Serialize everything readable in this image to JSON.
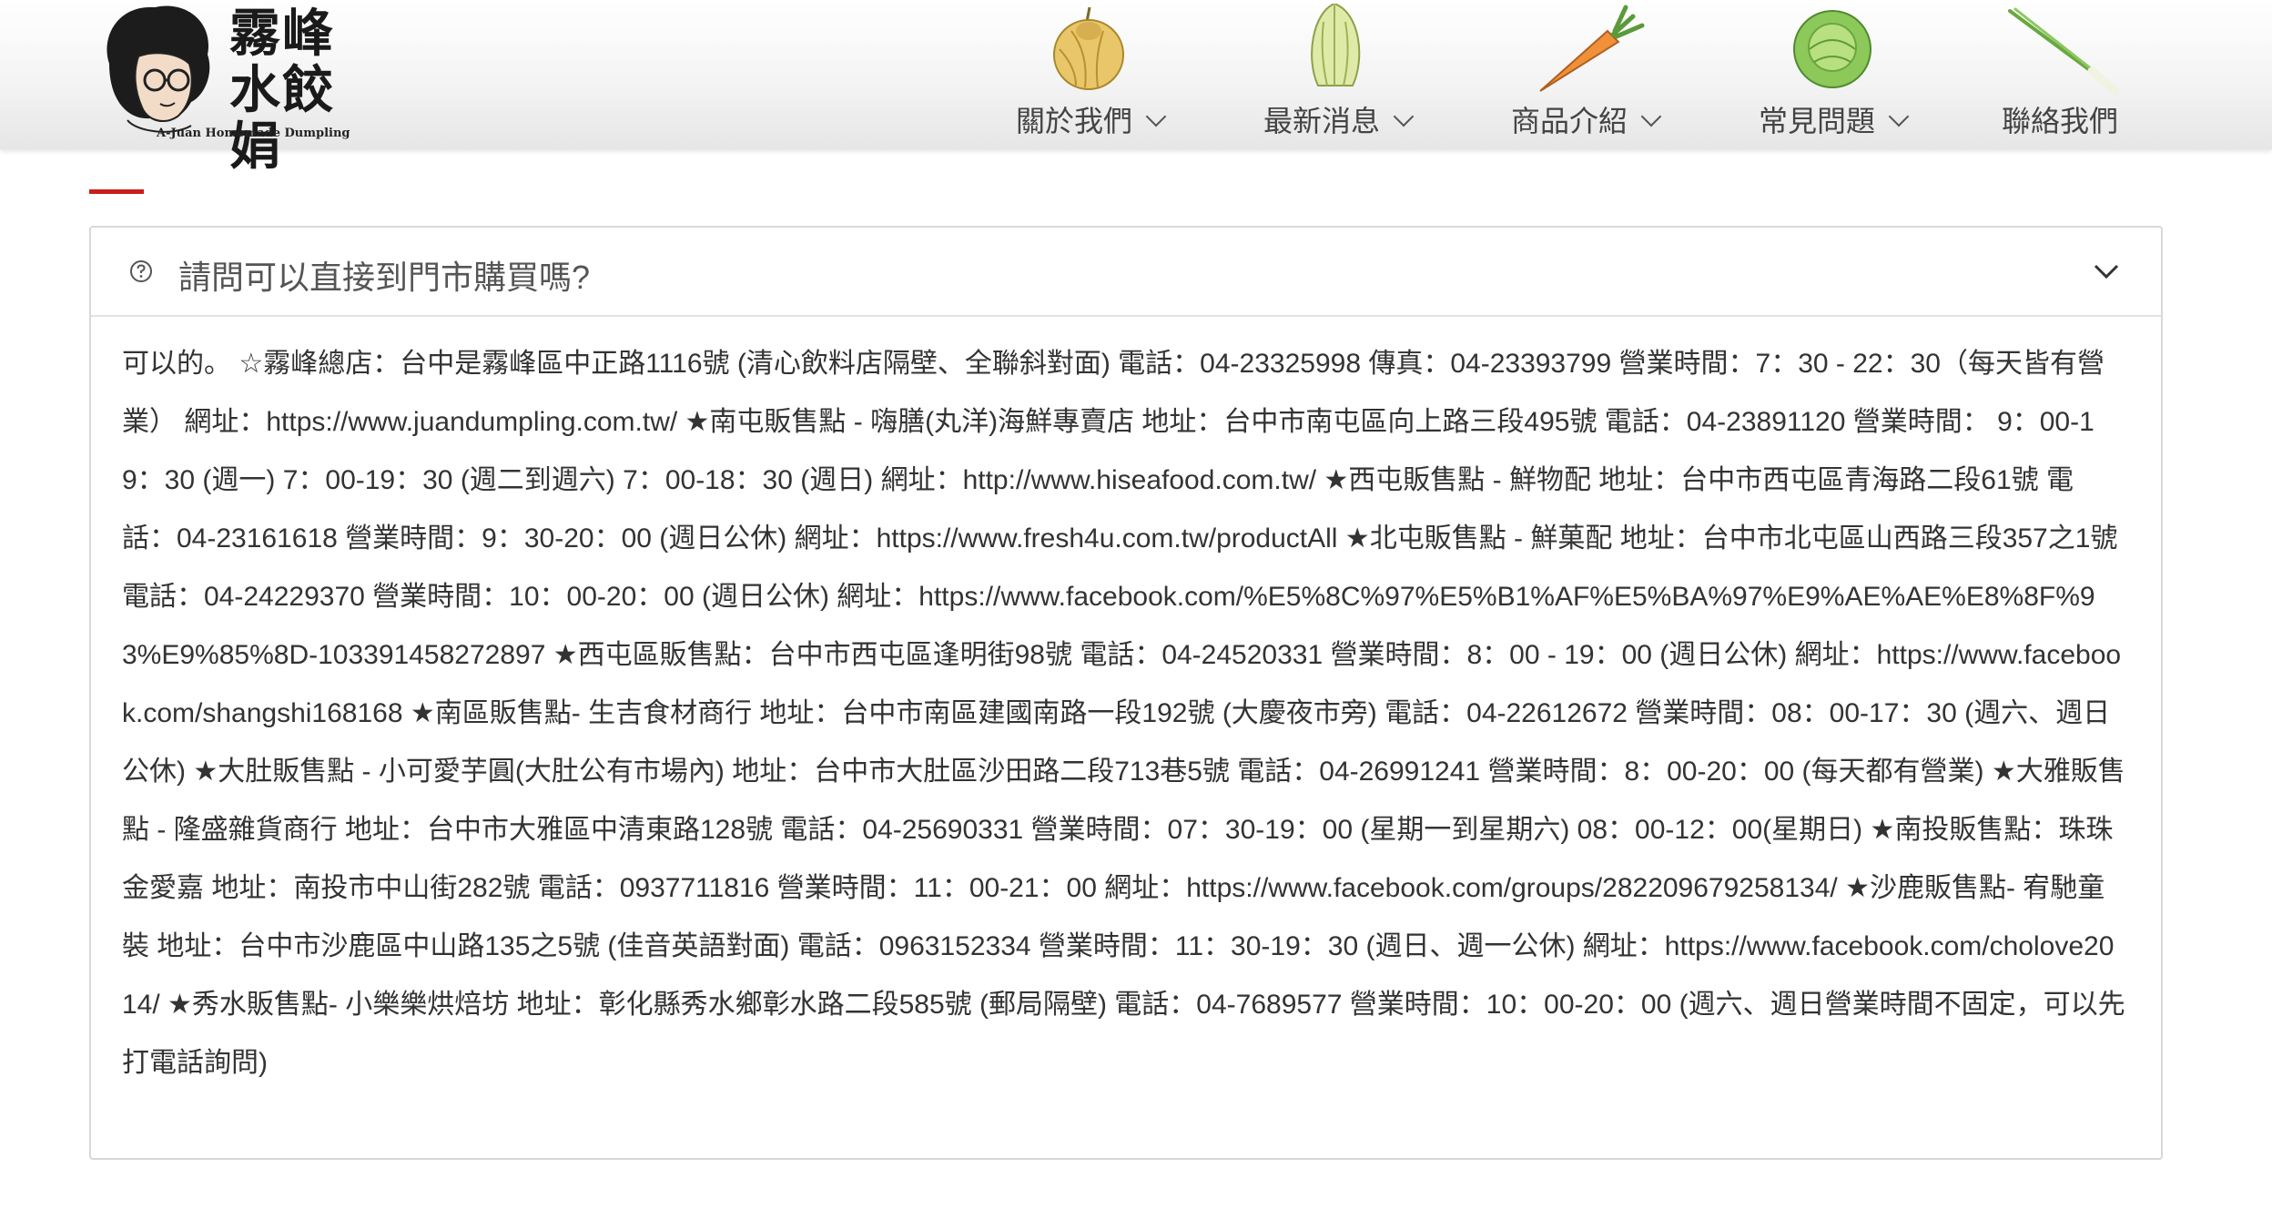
{
  "logo": {
    "title": "霧峰水餃娟",
    "subtitle": "A-Juan Homemade Dumpling"
  },
  "nav": [
    {
      "label": "關於我們",
      "icon": "onion-icon",
      "has_dropdown": true
    },
    {
      "label": "最新消息",
      "icon": "cabbage-icon",
      "has_dropdown": true
    },
    {
      "label": "商品介紹",
      "icon": "carrot-icon",
      "has_dropdown": true
    },
    {
      "label": "常見問題",
      "icon": "lettuce-icon",
      "has_dropdown": true
    },
    {
      "label": "聯絡我們",
      "icon": "scallion-icon",
      "has_dropdown": false
    }
  ],
  "faq": {
    "question": "請問可以直接到門市購買嗎?",
    "answer": "可以的。 ☆霧峰總店：台中是霧峰區中正路1116號 (清心飲料店隔壁、全聯斜對面) 電話：04-23325998 傳真：04-23393799 營業時間：7：30 - 22：30（每天皆有營業） 網址：https://www.juandumpling.com.tw/ ★南屯販售點 - 嗨膳(丸洋)海鮮專賣店 地址：台中市南屯區向上路三段495號 電話：04-23891120 營業時間： 9：00-19：30 (週一) 7：00-19：30 (週二到週六) 7：00-18：30 (週日) 網址：http://www.hiseafood.com.tw/ ★西屯販售點 - 鮮物配 地址：台中市西屯區青海路二段61號 電話：04-23161618 營業時間：9：30-20：00 (週日公休) 網址：https://www.fresh4u.com.tw/productAll ★北屯販售點 - 鮮菓配 地址：台中市北屯區山西路三段357之1號 電話：04-24229370 營業時間：10：00-20：00 (週日公休) 網址：https://www.facebook.com/%E5%8C%97%E5%B1%AF%E5%BA%97%E9%AE%AE%E8%8F%93%E9%85%8D-103391458272897 ★西屯區販售點：台中市西屯區逢明街98號 電話：04-24520331 營業時間：8：00 - 19：00 (週日公休) 網址：https://www.facebook.com/shangshi168168 ★南區販售點- 生吉食材商行 地址：台中市南區建國南路一段192號 (大慶夜市旁) 電話：04-22612672 營業時間：08：00-17：30 (週六、週日公休) ★大肚販售點 - 小可愛芋圓(大肚公有市場內) 地址：台中市大肚區沙田路二段713巷5號 電話：04-26991241 營業時間：8：00-20：00 (每天都有營業) ★大雅販售點 - 隆盛雜貨商行 地址：台中市大雅區中清東路128號 電話：04-25690331 營業時間：07：30-19：00 (星期一到星期六) 08：00-12：00(星期日) ★南投販售點：珠珠金愛嘉 地址：南投市中山街282號 電話：0937711816 營業時間：11：00-21：00 網址：https://www.facebook.com/groups/282209679258134/ ★沙鹿販售點- 宥馳童裝 地址：台中市沙鹿區中山路135之5號 (佳音英語對面) 電話：0963152334 營業時間：11：30-19：30 (週日、週一公休) 網址：https://www.facebook.com/cholove2014/ ★秀水販售點- 小樂樂烘焙坊 地址：彰化縣秀水鄉彰水路二段585號 (郵局隔壁) 電話：04-7689577 營業時間：10：00-20：00 (週六、週日營業時間不固定，可以先打電話詢問)"
  },
  "colors": {
    "accent_red": "#c81e1e",
    "border": "#d8d8d8",
    "text": "#333333"
  }
}
